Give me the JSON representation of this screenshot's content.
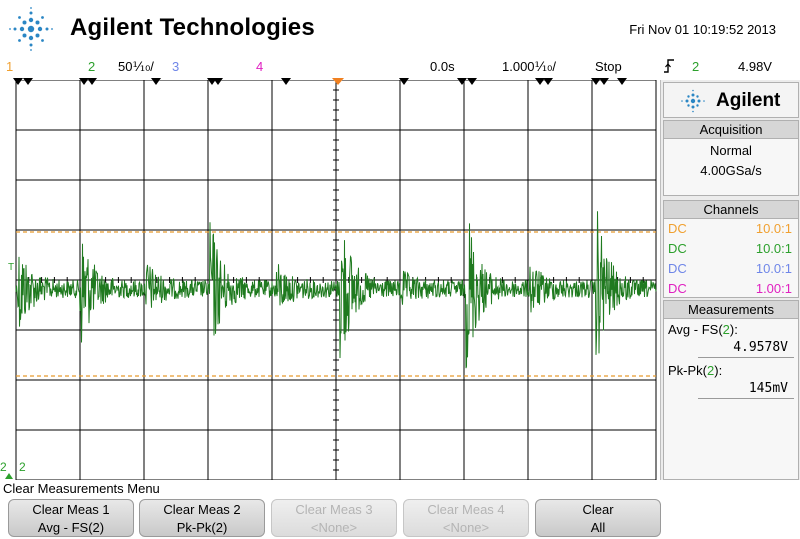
{
  "brand": {
    "name": "Agilent Technologies",
    "panel_logo": "Agilent"
  },
  "datetime": "Fri Nov 01 10:19:52 2013",
  "status": {
    "ch1": "1",
    "ch2": "2",
    "scale": "50⅒/",
    "ch3": "3",
    "ch4": "4",
    "delay": "0.0s",
    "timebase": "1.000⅒/",
    "run_state": "Stop",
    "trigger_icon": "trigger-edge-icon",
    "trigger_ch": "2",
    "trigger_level": "4.98V"
  },
  "colors": {
    "ch1": "#f0a030",
    "ch2": "#2ca02c",
    "ch3": "#6f86e8",
    "ch4": "#e020c0",
    "trace": "#1f7a1f",
    "grid": "#000000",
    "cursor": "#e69a2e"
  },
  "scope": {
    "ground_marker": "2"
  },
  "panel": {
    "acquisition": {
      "title": "Acquisition",
      "mode": "Normal",
      "rate": "4.00GSa/s"
    },
    "channels": {
      "title": "Channels",
      "rows": [
        {
          "coupling": "DC",
          "probe": "10.0:1"
        },
        {
          "coupling": "DC",
          "probe": "10.0:1"
        },
        {
          "coupling": "DC",
          "probe": "10.0:1"
        },
        {
          "coupling": "DC",
          "probe": "1.00:1"
        }
      ]
    },
    "measurements": {
      "title": "Measurements",
      "items": [
        {
          "label_prefix": "Avg - FS(",
          "label_ch": "2",
          "label_suffix": "):",
          "value": "4.9578V"
        },
        {
          "label_prefix": "Pk-Pk(",
          "label_ch": "2",
          "label_suffix": "):",
          "value": "145mV"
        }
      ]
    }
  },
  "menu": {
    "title": "Clear Measurements Menu",
    "keys": [
      {
        "line1": "Clear Meas 1",
        "line2": "Avg - FS(2)",
        "enabled": true
      },
      {
        "line1": "Clear Meas 2",
        "line2": "Pk-Pk(2)",
        "enabled": true
      },
      {
        "line1": "Clear Meas 3",
        "line2": "<None>",
        "enabled": false
      },
      {
        "line1": "Clear Meas 4",
        "line2": "<None>",
        "enabled": false
      },
      {
        "line1": "Clear",
        "line2": "All",
        "enabled": true
      }
    ]
  }
}
